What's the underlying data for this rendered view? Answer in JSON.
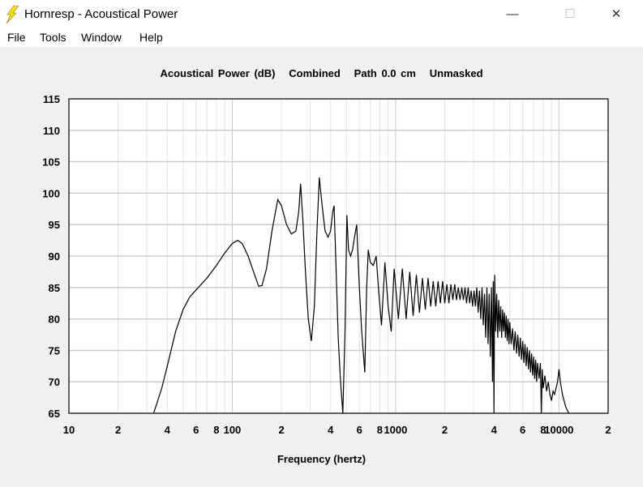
{
  "window": {
    "title": "Hornresp - Acoustical Power",
    "minimize": "—",
    "maximize": "☐",
    "close": "✕"
  },
  "menu": [
    "File",
    "Tools",
    "Window",
    "Help"
  ],
  "chart_data": {
    "type": "line",
    "title": "Acoustical Power (dB)   Combined   Path 0.0 cm   Unmasked",
    "xlabel": "Frequency (hertz)",
    "ylabel": "",
    "xscale": "log",
    "xlim": [
      10,
      20000
    ],
    "ylim": [
      65,
      115
    ],
    "grid": true,
    "line_color": "#000000",
    "x_tick_labels": [
      {
        "value": 10,
        "label": "10"
      },
      {
        "value": 20,
        "label": "2"
      },
      {
        "value": 40,
        "label": "4"
      },
      {
        "value": 60,
        "label": "6"
      },
      {
        "value": 80,
        "label": "8"
      },
      {
        "value": 100,
        "label": "100"
      },
      {
        "value": 200,
        "label": "2"
      },
      {
        "value": 400,
        "label": "4"
      },
      {
        "value": 600,
        "label": "6"
      },
      {
        "value": 800,
        "label": "8"
      },
      {
        "value": 1000,
        "label": "1000"
      },
      {
        "value": 2000,
        "label": "2"
      },
      {
        "value": 4000,
        "label": "4"
      },
      {
        "value": 6000,
        "label": "6"
      },
      {
        "value": 8000,
        "label": "8"
      },
      {
        "value": 10000,
        "label": "10000"
      },
      {
        "value": 20000,
        "label": "2"
      }
    ],
    "y_ticks": [
      65,
      70,
      75,
      80,
      85,
      90,
      95,
      100,
      105,
      110,
      115
    ],
    "points": [
      [
        33,
        65
      ],
      [
        37,
        69
      ],
      [
        40,
        72.5
      ],
      [
        45,
        78
      ],
      [
        50,
        81.5
      ],
      [
        55,
        83.5
      ],
      [
        62,
        85
      ],
      [
        70,
        86.5
      ],
      [
        80,
        88.5
      ],
      [
        90,
        90.5
      ],
      [
        100,
        92
      ],
      [
        108,
        92.5
      ],
      [
        115,
        92
      ],
      [
        125,
        90
      ],
      [
        135,
        87.5
      ],
      [
        145,
        85.2
      ],
      [
        152,
        85.3
      ],
      [
        162,
        88
      ],
      [
        175,
        94
      ],
      [
        190,
        99
      ],
      [
        200,
        98
      ],
      [
        215,
        95
      ],
      [
        230,
        93.5
      ],
      [
        245,
        94
      ],
      [
        255,
        97
      ],
      [
        262,
        101.5
      ],
      [
        270,
        96
      ],
      [
        280,
        88
      ],
      [
        292,
        80
      ],
      [
        305,
        76.5
      ],
      [
        318,
        82
      ],
      [
        330,
        94
      ],
      [
        341,
        102.5
      ],
      [
        355,
        98
      ],
      [
        370,
        94
      ],
      [
        386,
        93
      ],
      [
        400,
        94
      ],
      [
        412,
        97
      ],
      [
        420,
        98
      ],
      [
        432,
        88
      ],
      [
        445,
        77
      ],
      [
        460,
        70
      ],
      [
        475,
        65
      ],
      [
        490,
        78
      ],
      [
        503,
        96.5
      ],
      [
        515,
        91
      ],
      [
        530,
        90
      ],
      [
        545,
        91
      ],
      [
        560,
        93
      ],
      [
        578,
        95
      ],
      [
        600,
        85
      ],
      [
        620,
        78
      ],
      [
        648,
        71.5
      ],
      [
        665,
        85
      ],
      [
        680,
        91
      ],
      [
        700,
        89
      ],
      [
        730,
        88.5
      ],
      [
        760,
        90
      ],
      [
        790,
        84
      ],
      [
        820,
        79
      ],
      [
        860,
        89
      ],
      [
        900,
        82
      ],
      [
        940,
        78
      ],
      [
        980,
        88
      ],
      [
        1040,
        80
      ],
      [
        1100,
        88
      ],
      [
        1160,
        80
      ],
      [
        1220,
        87.5
      ],
      [
        1280,
        80.5
      ],
      [
        1340,
        87
      ],
      [
        1400,
        81
      ],
      [
        1460,
        86.5
      ],
      [
        1520,
        81.5
      ],
      [
        1580,
        86.5
      ],
      [
        1640,
        82
      ],
      [
        1700,
        86
      ],
      [
        1760,
        82
      ],
      [
        1820,
        86
      ],
      [
        1880,
        82.5
      ],
      [
        1940,
        86
      ],
      [
        2000,
        82.5
      ],
      [
        2060,
        85.5
      ],
      [
        2120,
        82.5
      ],
      [
        2180,
        85.5
      ],
      [
        2240,
        83
      ],
      [
        2300,
        85.5
      ],
      [
        2360,
        83
      ],
      [
        2420,
        85
      ],
      [
        2480,
        83
      ],
      [
        2540,
        85
      ],
      [
        2600,
        83
      ],
      [
        2660,
        85
      ],
      [
        2720,
        82.5
      ],
      [
        2780,
        85
      ],
      [
        2840,
        82.5
      ],
      [
        2900,
        84.5
      ],
      [
        2960,
        82
      ],
      [
        3020,
        84.5
      ],
      [
        3080,
        82
      ],
      [
        3140,
        85
      ],
      [
        3200,
        81
      ],
      [
        3260,
        84.5
      ],
      [
        3320,
        80
      ],
      [
        3380,
        85
      ],
      [
        3440,
        79
      ],
      [
        3500,
        84
      ],
      [
        3560,
        77
      ],
      [
        3620,
        85
      ],
      [
        3680,
        76
      ],
      [
        3740,
        84
      ],
      [
        3800,
        74
      ],
      [
        3860,
        85
      ],
      [
        3920,
        70
      ],
      [
        3960,
        86
      ],
      [
        4000,
        65
      ],
      [
        4040,
        87
      ],
      [
        4100,
        78
      ],
      [
        4160,
        84
      ],
      [
        4220,
        77
      ],
      [
        4280,
        83
      ],
      [
        4340,
        78
      ],
      [
        4400,
        82
      ],
      [
        4460,
        77
      ],
      [
        4520,
        81.5
      ],
      [
        4580,
        78
      ],
      [
        4640,
        81
      ],
      [
        4700,
        77
      ],
      [
        4760,
        80.5
      ],
      [
        4820,
        76.5
      ],
      [
        4880,
        80
      ],
      [
        4940,
        76
      ],
      [
        5000,
        79.5
      ],
      [
        5100,
        76
      ],
      [
        5200,
        78.5
      ],
      [
        5300,
        75
      ],
      [
        5400,
        78
      ],
      [
        5500,
        74.5
      ],
      [
        5600,
        77.5
      ],
      [
        5700,
        74
      ],
      [
        5800,
        77
      ],
      [
        5900,
        73.5
      ],
      [
        6000,
        76.5
      ],
      [
        6100,
        73
      ],
      [
        6200,
        76
      ],
      [
        6300,
        72.5
      ],
      [
        6400,
        75.5
      ],
      [
        6500,
        72
      ],
      [
        6600,
        75
      ],
      [
        6700,
        71.5
      ],
      [
        6800,
        74.5
      ],
      [
        6900,
        71
      ],
      [
        7000,
        74
      ],
      [
        7100,
        70.5
      ],
      [
        7200,
        73.5
      ],
      [
        7300,
        70
      ],
      [
        7400,
        73
      ],
      [
        7550,
        70.5
      ],
      [
        7700,
        73
      ],
      [
        7800,
        65
      ],
      [
        7900,
        72
      ],
      [
        8000,
        69
      ],
      [
        8200,
        71
      ],
      [
        8400,
        68.5
      ],
      [
        8600,
        70
      ],
      [
        8800,
        68
      ],
      [
        9000,
        67
      ],
      [
        9200,
        68.5
      ],
      [
        9400,
        68
      ],
      [
        9600,
        69
      ],
      [
        9800,
        70
      ],
      [
        10000,
        72
      ],
      [
        10200,
        70
      ],
      [
        10500,
        68
      ],
      [
        11000,
        66
      ],
      [
        11500,
        65
      ]
    ]
  }
}
